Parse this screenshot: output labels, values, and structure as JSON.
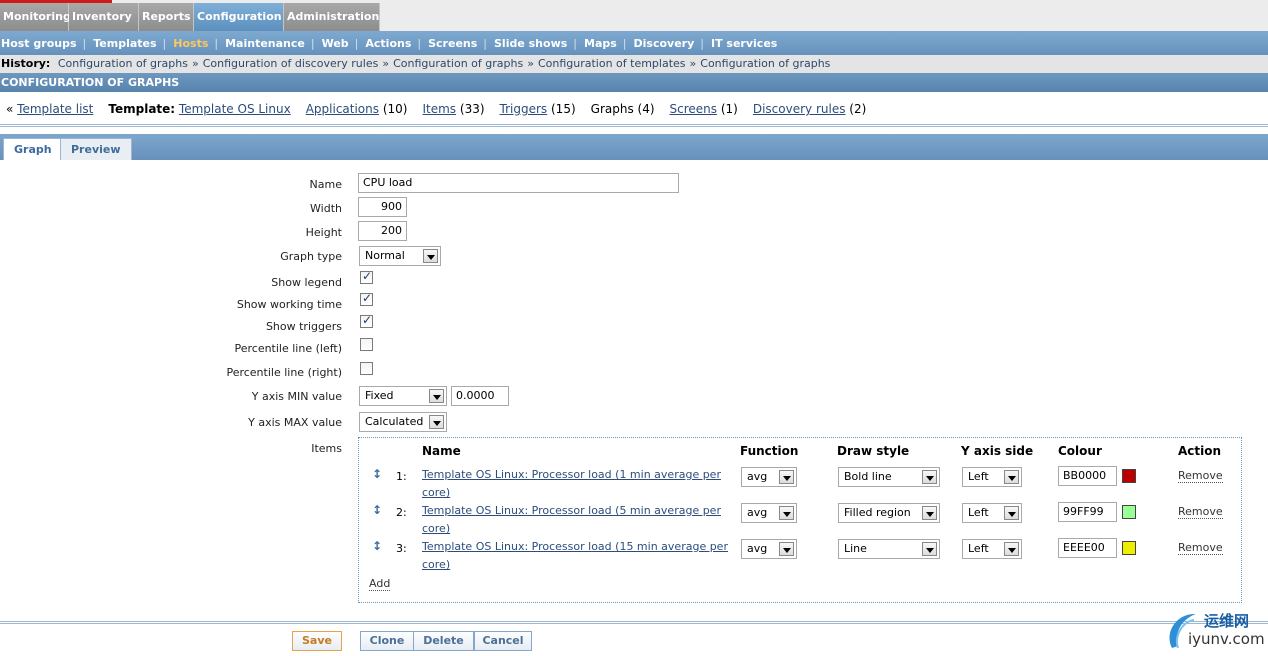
{
  "main_menu": [
    "Monitoring",
    "Inventory",
    "Reports",
    "Configuration",
    "Administration"
  ],
  "sub_menu": [
    "Host groups",
    "Templates",
    "Hosts",
    "Maintenance",
    "Web",
    "Actions",
    "Screens",
    "Slide shows",
    "Maps",
    "Discovery",
    "IT services"
  ],
  "history": {
    "label": "History:",
    "links": [
      "Configuration of graphs",
      "Configuration of discovery rules",
      "Configuration of graphs",
      "Configuration of templates",
      "Configuration of graphs"
    ],
    "separator": "»"
  },
  "title": "CONFIGURATION OF GRAPHS",
  "template_nav": {
    "back": "«",
    "template_list": "Template list",
    "template_label": "Template:",
    "template_name": "Template OS Linux",
    "applications": "Applications",
    "applications_count": "(10)",
    "items": "Items",
    "items_count": "(33)",
    "triggers": "Triggers",
    "triggers_count": "(15)",
    "graphs": "Graphs (4)",
    "screens": "Screens",
    "screens_count": "(1)",
    "discovery": "Discovery rules",
    "discovery_count": "(2)"
  },
  "tabs": [
    "Graph",
    "Preview"
  ],
  "form": {
    "name_label": "Name",
    "name_value": "CPU load",
    "width_label": "Width",
    "width_value": "900",
    "height_label": "Height",
    "height_value": "200",
    "graph_type_label": "Graph type",
    "graph_type_value": "Normal",
    "show_legend_label": "Show legend",
    "show_working_time_label": "Show working time",
    "show_triggers_label": "Show triggers",
    "percentile_left_label": "Percentile line (left)",
    "percentile_right_label": "Percentile line (right)",
    "ymin_label": "Y axis MIN value",
    "ymin_type": "Fixed",
    "ymin_value": "0.0000",
    "ymax_label": "Y axis MAX value",
    "ymax_type": "Calculated",
    "items_label": "Items"
  },
  "items_table": {
    "headers": [
      "Name",
      "Function",
      "Draw style",
      "Y axis side",
      "Colour",
      "Action"
    ],
    "rows": [
      {
        "num": "1:",
        "name": "Template OS Linux: Processor load (1 min average per core)",
        "function": "avg",
        "draw_style": "Bold line",
        "y_side": "Left",
        "colour": "BB0000",
        "action": "Remove"
      },
      {
        "num": "2:",
        "name": "Template OS Linux: Processor load (5 min average per core)",
        "function": "avg",
        "draw_style": "Filled region",
        "y_side": "Left",
        "colour": "99FF99",
        "action": "Remove"
      },
      {
        "num": "3:",
        "name": "Template OS Linux: Processor load (15 min average per core)",
        "function": "avg",
        "draw_style": "Line",
        "y_side": "Left",
        "colour": "EEEE00",
        "action": "Remove"
      }
    ],
    "add": "Add"
  },
  "buttons": {
    "save": "Save",
    "clone": "Clone",
    "delete": "Delete",
    "cancel": "Cancel"
  },
  "watermark": {
    "cn": "运维网",
    "site": "iyunv.com"
  },
  "colors": {
    "accent": "#6592bd",
    "active_menu": "#5c8fbd",
    "hosts_active": "#ffc85a"
  }
}
